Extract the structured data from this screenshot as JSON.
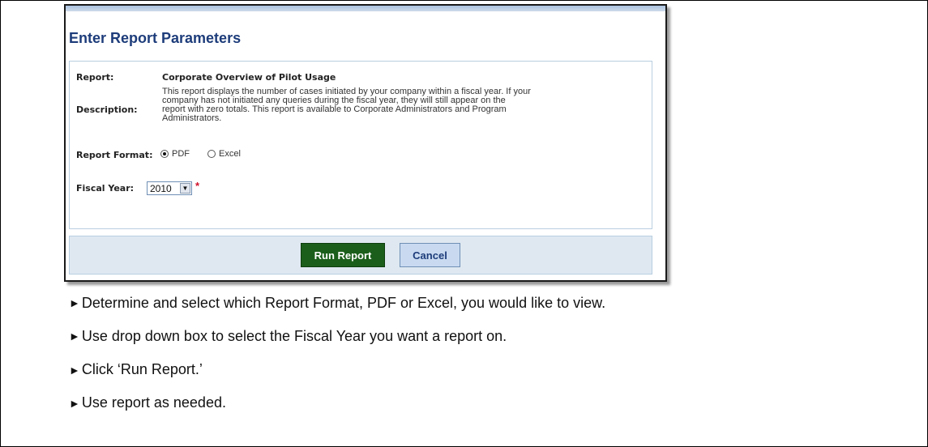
{
  "form": {
    "title": "Enter Report Parameters",
    "report_label": "Report:",
    "report_value": "Corporate Overview of Pilot Usage",
    "description_label": "Description:",
    "description_lines": [
      "This report displays the number of cases initiated by your company within a fiscal year. If your",
      "company has not initiated any queries during the fiscal year, they will still appear on the",
      "report with zero totals. This report is available to Corporate Administrators and Program",
      "Administrators."
    ],
    "format_label": "Report Format:",
    "format_options": [
      "PDF",
      "Excel"
    ],
    "format_selected": "PDF",
    "fiscal_year_label": "Fiscal Year:",
    "fiscal_year_value": "2010",
    "required_marker": "*",
    "dropdown_arrow": "▼",
    "run_button": "Run Report",
    "cancel_button": "Cancel"
  },
  "instructions": {
    "bullet": "►",
    "items": [
      "Determine and select which Report Format, PDF or Excel, you would like to view.",
      "Use drop down box to select the Fiscal Year you want a report on.",
      "Click ‘Run Report.’",
      "Use report as needed."
    ]
  },
  "colors": {
    "heading": "#1d3c7a",
    "run_button_bg": "#1b5e1b",
    "cancel_button_bg": "#c9daf0",
    "required": "#d0122a",
    "panel_border": "#b9cfe0",
    "footer_bg": "#dfe8f1"
  }
}
